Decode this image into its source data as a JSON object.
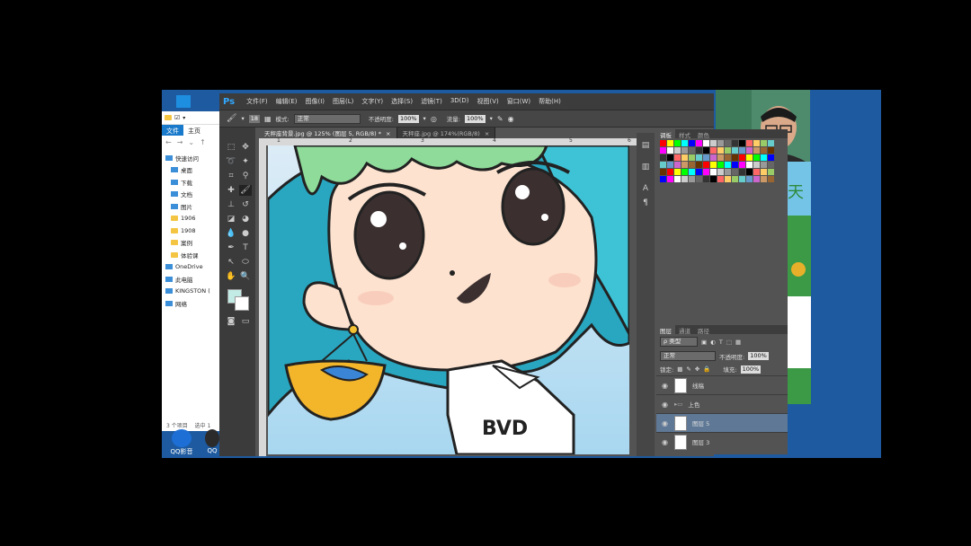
{
  "explorer": {
    "tabs": [
      "文件",
      "主页"
    ],
    "nav_items": [
      {
        "label": "快速访问",
        "icon": "star-icon",
        "top": true
      },
      {
        "label": "桌面",
        "icon": "desktop-icon"
      },
      {
        "label": "下载",
        "icon": "download-icon"
      },
      {
        "label": "文档",
        "icon": "document-icon"
      },
      {
        "label": "图片",
        "icon": "picture-icon"
      },
      {
        "label": "1906",
        "icon": "folder-icon"
      },
      {
        "label": "1908",
        "icon": "folder-icon"
      },
      {
        "label": "案例",
        "icon": "folder-icon"
      },
      {
        "label": "体验课",
        "icon": "folder-icon"
      },
      {
        "label": "OneDrive",
        "icon": "cloud-icon",
        "top": true
      },
      {
        "label": "此电脑",
        "icon": "computer-icon",
        "top": true
      },
      {
        "label": "KINGSTON (",
        "icon": "drive-icon",
        "top": true
      },
      {
        "label": "网络",
        "icon": "network-icon",
        "top": true
      }
    ],
    "status_left": "3 个项目",
    "status_right": "选中 1"
  },
  "desktop_icons": [
    {
      "label": "QQ影音"
    },
    {
      "label": "QQ"
    }
  ],
  "photoshop": {
    "logo": "Ps",
    "menu": [
      "文件(F)",
      "编辑(E)",
      "图像(I)",
      "图层(L)",
      "文字(Y)",
      "选择(S)",
      "滤镜(T)",
      "3D(D)",
      "视图(V)",
      "窗口(W)",
      "帮助(H)"
    ],
    "options": {
      "brush_size": "18",
      "mode_label": "模式:",
      "mode_value": "正常",
      "opacity_label": "不透明度:",
      "opacity_value": "100%",
      "flow_label": "流量:",
      "flow_value": "100%"
    },
    "doc_tabs": [
      {
        "label": "天秤座背景.jpg @ 125% (图层 5, RGB/8) *",
        "active": true
      },
      {
        "label": "天秤座.jpg @ 174%(RGB/8)",
        "active": false
      }
    ],
    "ruler_marks": [
      "1",
      "2",
      "3",
      "4",
      "5",
      "6"
    ],
    "canvas_text": "BVD"
  },
  "panels": {
    "swatch_tabs": [
      "调板",
      "样式",
      "颜色"
    ],
    "layer_tabs": [
      "图层",
      "通道",
      "路径"
    ],
    "filter_label": "ρ 类型",
    "blend_mode": "正常",
    "opacity_label": "不透明度:",
    "opacity_value": "100%",
    "lock_label": "锁定:",
    "fill_label": "填充:",
    "fill_value": "100%",
    "layers": [
      {
        "name": "线稿",
        "type": "layer",
        "selected": false
      },
      {
        "name": "上色",
        "type": "group",
        "selected": false
      },
      {
        "name": "图层 5",
        "type": "layer",
        "selected": true
      },
      {
        "name": "图层 3",
        "type": "layer",
        "selected": false
      }
    ]
  },
  "colors": {
    "ps_bg": "#535353",
    "menubar": "#3c3c3c",
    "selection": "#5e7896",
    "explorer_accent": "#1979ca",
    "hair": "#29a7c0",
    "skin": "#fde2cf"
  }
}
